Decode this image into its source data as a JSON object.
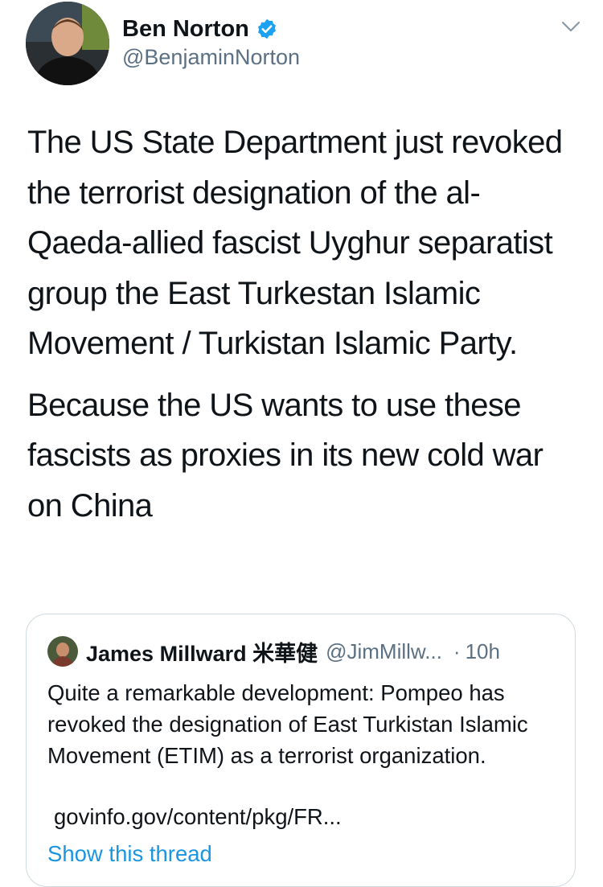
{
  "author": {
    "name": "Ben Norton",
    "handle": "@BenjaminNorton",
    "verified_icon": "verified-badge-icon",
    "menu_icon": "chevron-down-icon"
  },
  "tweet": {
    "paragraphs": [
      "The US State Department just revoked the terrorist designation of the al-Qaeda-allied fascist Uyghur separatist group the East Turkestan Islamic Movement / Turkistan Islamic Party.",
      "Because the US wants to use these fascists as proxies in its new cold war on China"
    ]
  },
  "quote": {
    "name": "James Millward 米華健",
    "handle": "@JimMillw...",
    "separator": "·",
    "time": "10h",
    "text": "Quite a remarkable development: Pompeo has revoked the designation of East Turkistan Islamic Movement (ETIM) as a terrorist organization.",
    "link": "govinfo.gov/content/pkg/FR...",
    "show_thread": "Show this thread"
  },
  "colors": {
    "text": "#0f1419",
    "secondary": "#5b7083",
    "link": "#1b95e0",
    "verified": "#1da1f2",
    "border": "#cfd9de"
  }
}
